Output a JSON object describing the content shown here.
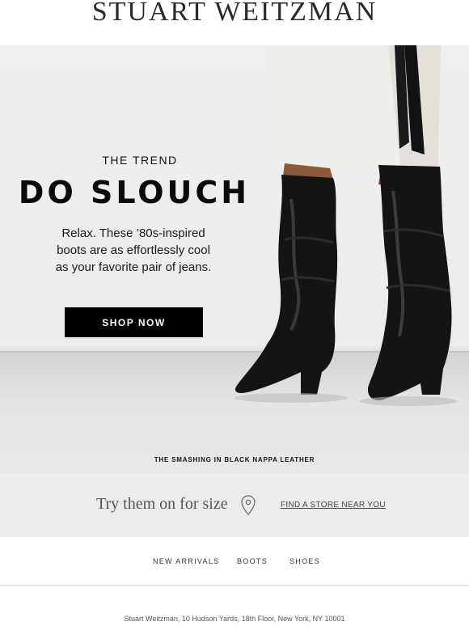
{
  "brand": {
    "logo_text": "STUART WEITZMAN"
  },
  "hero": {
    "eyebrow": "THE TREND",
    "headline": "DO SLOUCH",
    "body_line1": "Relax. These ’80s-inspired",
    "body_line2": "boots are as effortlessly cool",
    "body_line3": "as your favorite pair of jeans.",
    "cta_label": "SHOP NOW",
    "caption": "THE SMASHING IN BLACK NAPPA LEATHER"
  },
  "store_locator": {
    "prompt": "Try them on for size",
    "icon": "location-pin-icon",
    "link_label": "FIND A STORE NEAR YOU"
  },
  "nav": {
    "items": [
      {
        "label": "NEW ARRIVALS"
      },
      {
        "label": "BOOTS"
      },
      {
        "label": "SHOES"
      }
    ]
  },
  "footer": {
    "address": "Stuart Weitzman, 10 Hudson Yards, 18th Floor, New York, NY 10001"
  },
  "colors": {
    "cta_background": "#000000",
    "cta_text": "#ffffff",
    "store_band": "#ececec",
    "hero_background": "#efefef"
  }
}
